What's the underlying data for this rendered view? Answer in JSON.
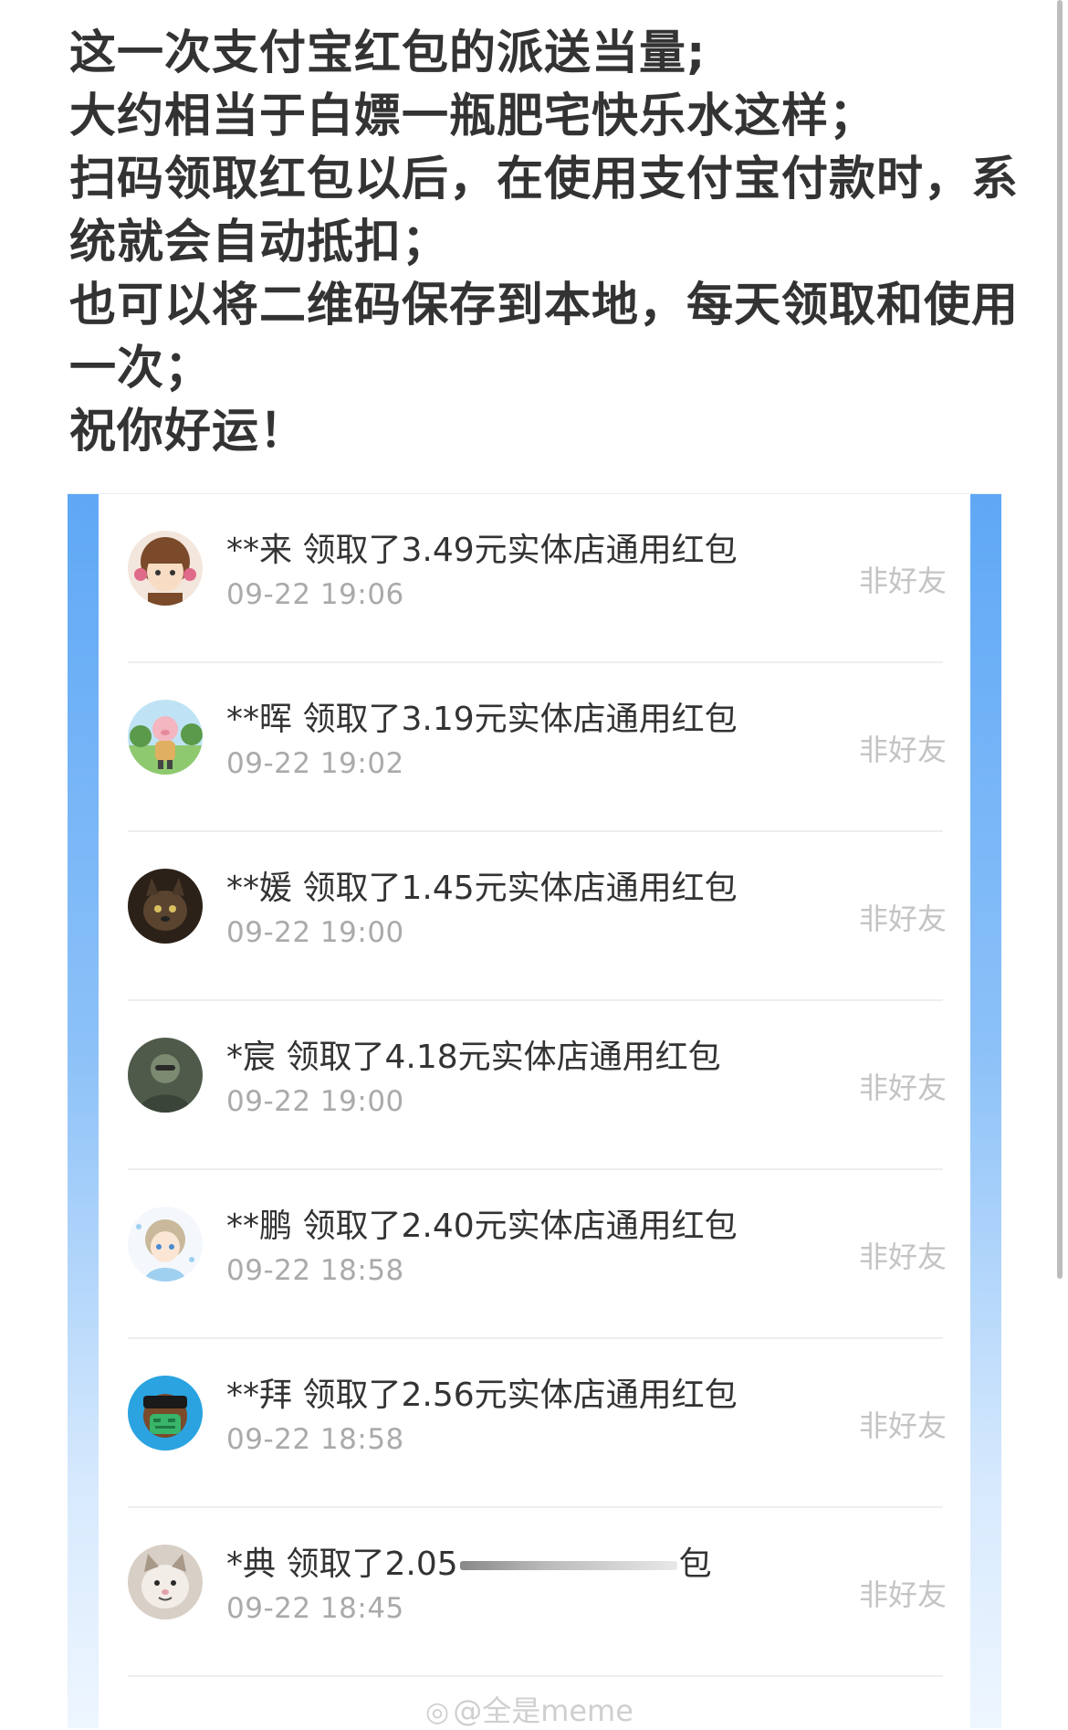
{
  "intro_lines": [
    "这一次支付宝红包的派送当量;",
    "大约相当于白嫖一瓶肥宅快乐水这样；",
    "扫码领取红包以后，在使用支付宝付款时，系",
    "统就会自动抵扣；",
    "也可以将二维码保存到本地，每天领取和使用",
    "一次；",
    "祝你好运！"
  ],
  "records": [
    {
      "name": "**来",
      "action": "领取了3.49元实体店通用红包",
      "time": "09-22 19:06",
      "tag": "非好友",
      "avatar": "anime-girl-avatar"
    },
    {
      "name": "**晖",
      "action": "领取了3.19元实体店通用红包",
      "time": "09-22 19:02",
      "tag": "非好友",
      "avatar": "cartoon-pig-avatar"
    },
    {
      "name": "**媛",
      "action": "领取了1.45元实体店通用红包",
      "time": "09-22 19:00",
      "tag": "非好友",
      "avatar": "cat-avatar"
    },
    {
      "name": "*宸",
      "action": "领取了4.18元实体店通用红包",
      "time": "09-22 19:00",
      "tag": "非好友",
      "avatar": "person-avatar"
    },
    {
      "name": "**鹏",
      "action": "领取了2.40元实体店通用红包",
      "time": "09-22 18:58",
      "tag": "非好友",
      "avatar": "anime-girl-blue-avatar"
    },
    {
      "name": "**拜",
      "action": "领取了2.56元实体店通用红包",
      "time": "09-22 18:58",
      "tag": "非好友",
      "avatar": "cartoon-mask-avatar"
    },
    {
      "name": "*典",
      "action_prefix": "领取了2.05",
      "action_suffix": "包",
      "time": "09-22 18:45",
      "tag": "非好友",
      "avatar": "cat-face-avatar"
    }
  ],
  "watermark": "@全是meme",
  "colors": {
    "frame_top": "#5fa8f6",
    "frame_bottom": "#eef6ff",
    "text": "#333333",
    "muted": "#aaaaaa"
  }
}
